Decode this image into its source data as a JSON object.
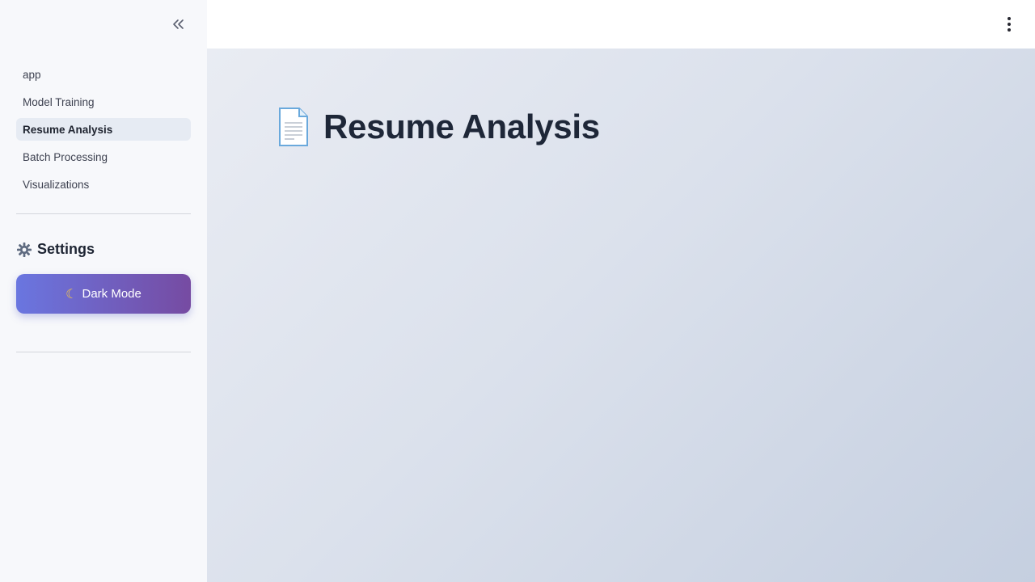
{
  "sidebar": {
    "collapse_icon": "chevron-double-left-icon",
    "nav_items": [
      {
        "label": "app",
        "active": false
      },
      {
        "label": "Model Training",
        "active": false
      },
      {
        "label": "Resume Analysis",
        "active": true
      },
      {
        "label": "Batch Processing",
        "active": false
      },
      {
        "label": "Visualizations",
        "active": false
      }
    ],
    "settings_icon": "gear-icon",
    "settings_title": "Settings",
    "dark_mode_icon": "moon-icon",
    "dark_mode_label": "Dark Mode"
  },
  "header": {
    "menu_icon": "kebab-menu-icon"
  },
  "main": {
    "title_icon": "document-icon",
    "title": "Resume Analysis"
  },
  "colors": {
    "button_gradient_start": "#6a76e0",
    "button_gradient_end": "#764ba2",
    "active_nav_bg": "#e6ebf3",
    "sidebar_bg": "#f7f8fb"
  }
}
